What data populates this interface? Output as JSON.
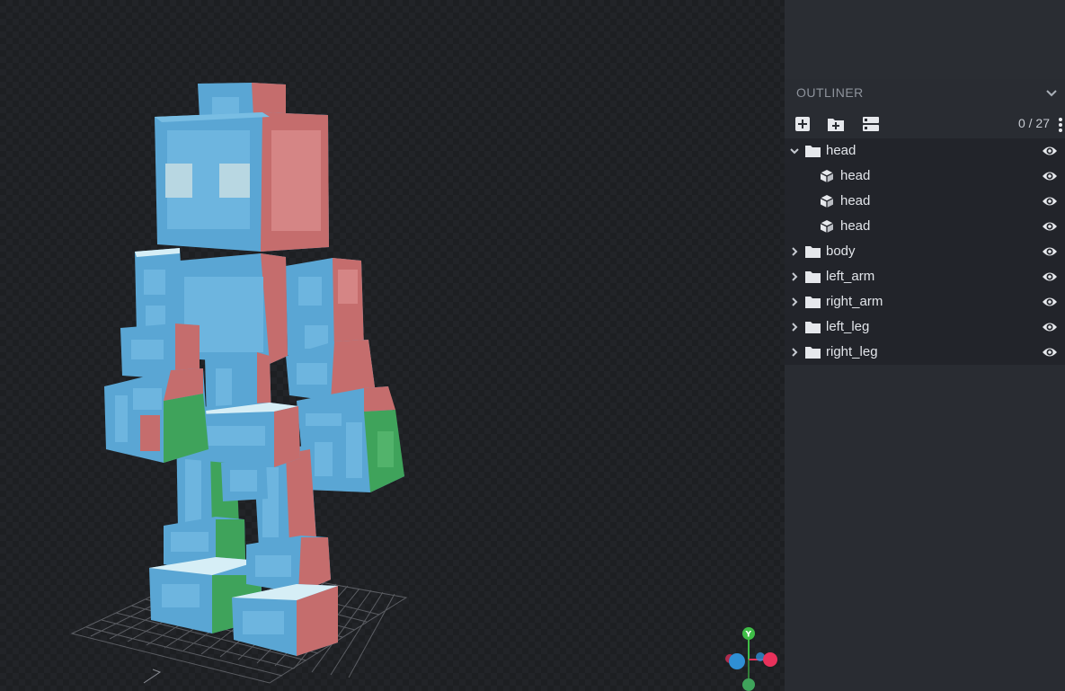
{
  "outliner": {
    "title": "OUTLINER",
    "count": "0 / 27",
    "toolbar": {
      "add_cube_icon": "add-cube-icon",
      "add_group_icon": "add-group-icon",
      "toggle_icon": "toggle-options-icon"
    },
    "items": [
      {
        "label": "head",
        "type": "group",
        "expanded": true
      },
      {
        "label": "head",
        "type": "cube"
      },
      {
        "label": "head",
        "type": "cube"
      },
      {
        "label": "head",
        "type": "cube"
      },
      {
        "label": "body",
        "type": "group",
        "expanded": false
      },
      {
        "label": "left_arm",
        "type": "group",
        "expanded": false
      },
      {
        "label": "right_arm",
        "type": "group",
        "expanded": false
      },
      {
        "label": "left_leg",
        "type": "group",
        "expanded": false
      },
      {
        "label": "right_leg",
        "type": "group",
        "expanded": false
      }
    ]
  },
  "gizmo": {
    "y_label": "Y",
    "colors": {
      "x": "#e8315b",
      "y": "#3fbc47",
      "z": "#2f8fd4"
    }
  },
  "model_colors": {
    "north": "#5aa6d4",
    "east": "#c56d6d",
    "up": "#d6eef6",
    "south": "#3fa35b"
  }
}
